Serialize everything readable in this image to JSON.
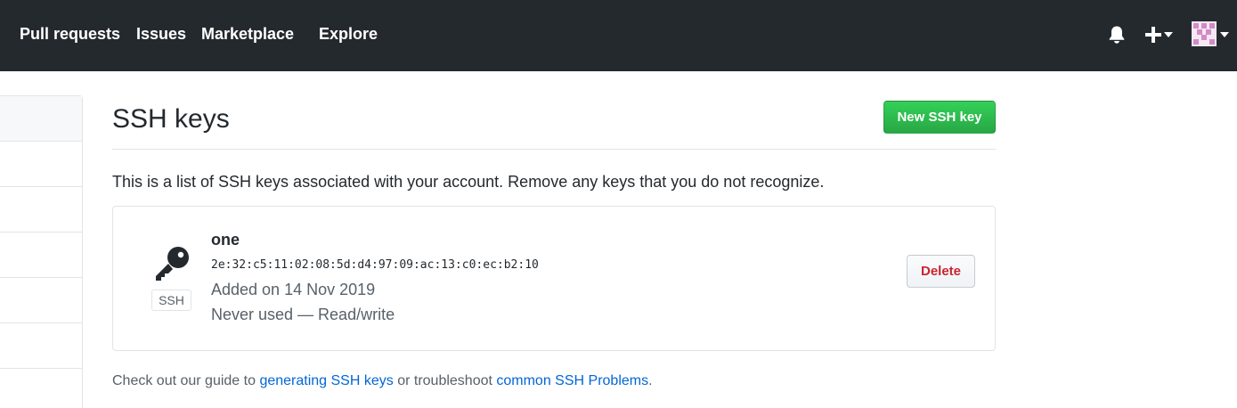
{
  "header": {
    "nav": [
      "Pull requests",
      "Issues",
      "Marketplace",
      "Explore"
    ],
    "icons": [
      "bell-icon",
      "plus-icon",
      "caret-down-icon",
      "avatar"
    ]
  },
  "sidebar": {
    "items": [
      "",
      "",
      "",
      "",
      "",
      ""
    ]
  },
  "main": {
    "title": "SSH keys",
    "new_key_button": "New SSH key",
    "intro": "This is a list of SSH keys associated with your account. Remove any keys that you do not recognize.",
    "keys": [
      {
        "name": "one",
        "fingerprint": "2e:32:c5:11:02:08:5d:d4:97:09:ac:13:c0:ec:b2:10",
        "badge": "SSH",
        "added": "Added on 14 Nov 2019",
        "usage": "Never used — Read/write",
        "delete_label": "Delete",
        "icon": "key-icon"
      }
    ],
    "footer": {
      "prefix": "Check out our guide to ",
      "link1": "generating SSH keys",
      "middle": " or troubleshoot ",
      "link2": "common SSH Problems",
      "suffix": "."
    }
  },
  "colors": {
    "header_bg": "#24292e",
    "primary_button": "#2ea44f",
    "danger_text": "#cb2431",
    "link": "#0366d6"
  }
}
